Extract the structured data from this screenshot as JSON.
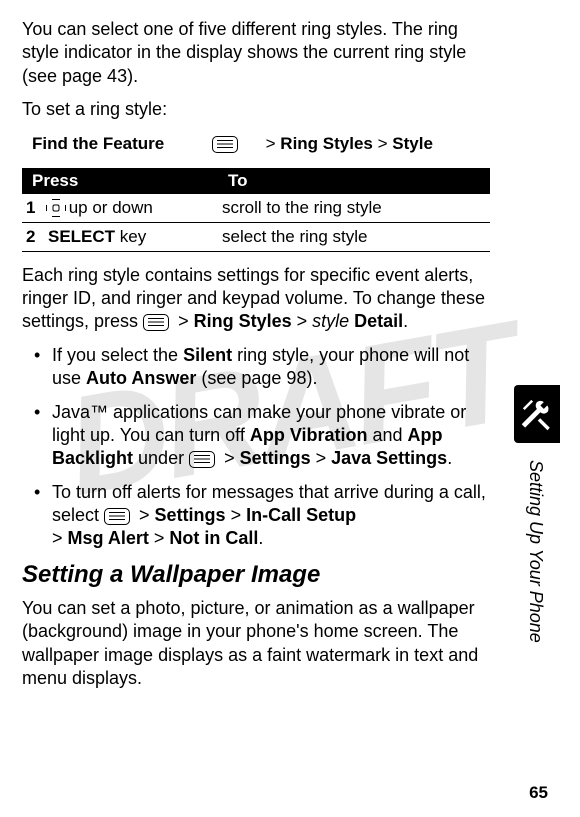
{
  "watermark": "DRAFT",
  "intro_para": "You can select one of five different ring styles. The ring style indicator in the display shows the current ring style (see page 43).",
  "to_set": "To set a ring style:",
  "find": {
    "label": "Find the Feature",
    "sep": ">",
    "path1": "Ring Styles",
    "path2": "Style"
  },
  "table": {
    "header_press": "Press",
    "header_to": "To",
    "rows": [
      {
        "num": "1",
        "press_suffix": " up or down",
        "to": "scroll to the ring style"
      },
      {
        "num": "2",
        "press_key": "SELECT",
        "press_suffix": " key",
        "to": "select the ring style"
      }
    ]
  },
  "para_after": {
    "pre": "Each ring style contains settings for specific event alerts, ringer ID, and ringer and keypad volume. To change these settings, press ",
    "sep": " > ",
    "ring_styles": "Ring Styles",
    "style": "style",
    "detail": " Detail",
    "dot": "."
  },
  "bullets": [
    {
      "pre": "If you select the ",
      "b1": "Silent",
      "mid": " ring style, your phone will not use ",
      "b2": "Auto Answer",
      "post": " (see page 98)."
    },
    {
      "pre": "Java™ applications can make your phone vibrate or light up. You can turn off ",
      "b1": "App Vibration",
      "mid": " and ",
      "b2": "App Backlight",
      "post_pre": " under ",
      "sep": " > ",
      "settings": "Settings",
      "java": "Java Settings",
      "dot": "."
    },
    {
      "pre": "To turn off alerts for messages that arrive during a call, select ",
      "sep": " > ",
      "settings": "Settings",
      "incall": "In-Call Setup",
      "msg": "Msg Alert",
      "notincall": "Not in Call",
      "dot": "."
    }
  ],
  "heading": "Setting a Wallpaper Image",
  "wallpaper_para": "You can set a photo, picture, or animation as a wallpaper (background) image in your phone's home screen. The wallpaper image displays as a faint watermark in text and menu displays.",
  "side_label": "Setting Up Your Phone",
  "page_number": "65"
}
